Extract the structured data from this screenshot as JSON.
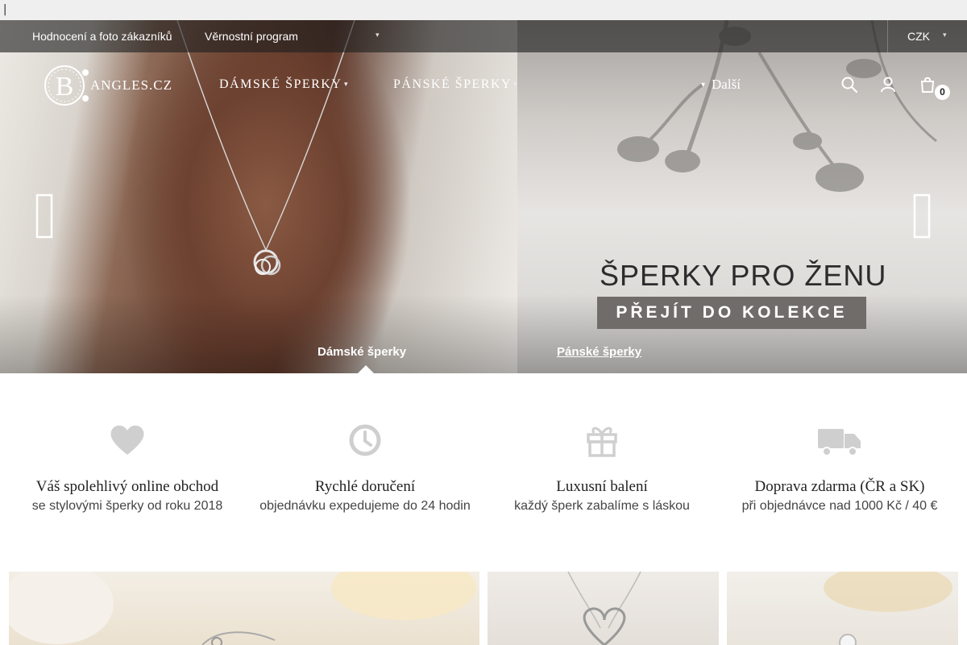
{
  "browser": {
    "cursor": "|"
  },
  "topbar": {
    "links": [
      "Hodnocení a foto zákazníků",
      "Věrnostní program"
    ],
    "caret": "▾",
    "currency": "CZK"
  },
  "header": {
    "logo_text": "ANGLES.CZ",
    "logo_letter": "B",
    "nav": [
      {
        "label": "DÁMSKÉ ŠPERKY"
      },
      {
        "label": "PÁNSKÉ ŠPERKY"
      }
    ],
    "more_icon": "▾",
    "more_label": "Další",
    "icons": [
      "search-icon",
      "user-icon",
      "cart-icon"
    ],
    "cart_count": "0"
  },
  "hero": {
    "banner_title": "ŠPERKY PRO ŽENU",
    "banner_cta": "PŘEJÍT DO KOLEKCE",
    "tabs": [
      {
        "label": "Dámské šperky",
        "active": true
      },
      {
        "label": "Pánské šperky",
        "active": false
      }
    ]
  },
  "features": [
    {
      "icon": "heart-icon",
      "title": "Váš spolehlivý online obchod",
      "subtitle": "se stylovými šperky od roku 2018"
    },
    {
      "icon": "clock-icon",
      "title": "Rychlé doručení",
      "subtitle": "objednávku expedujeme do 24 hodin"
    },
    {
      "icon": "gift-icon",
      "title": "Luxusní balení",
      "subtitle": "každý šperk zabalíme s láskou"
    },
    {
      "icon": "truck-icon",
      "title": "Doprava zdarma (ČR a SK)",
      "subtitle": "při objednávce nad 1000 Kč / 40 €"
    }
  ],
  "colors": {
    "topbar_bg": "#1e1e1e",
    "feature_icon": "#cfcfcf",
    "cta_bg": "#6f6c69"
  }
}
